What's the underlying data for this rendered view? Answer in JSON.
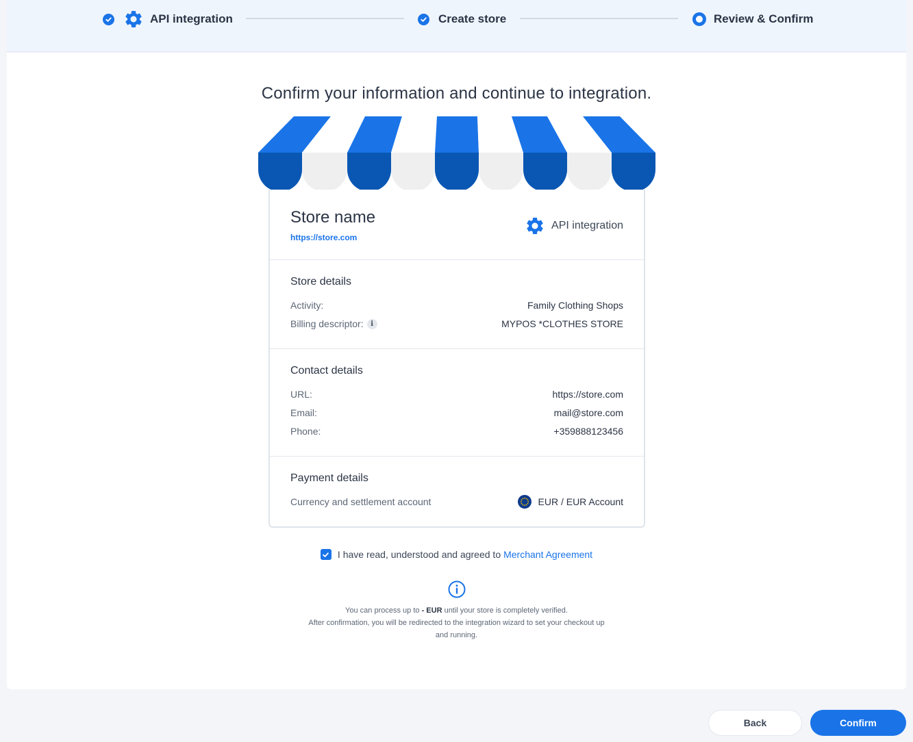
{
  "stepper": {
    "steps": [
      {
        "label": "API integration",
        "state": "done"
      },
      {
        "label": "Create store",
        "state": "done"
      },
      {
        "label": "Review & Confirm",
        "state": "current"
      }
    ]
  },
  "headline": "Confirm your information and continue to integration.",
  "store": {
    "name": "Store name",
    "url": "https://store.com",
    "integration_type": "API integration"
  },
  "store_details": {
    "title": "Store details",
    "activity_label": "Activity:",
    "activity_value": "Family Clothing Shops",
    "billing_label": "Billing descriptor:",
    "billing_value": "MYPOS *CLOTHES STORE",
    "info_glyph": "i"
  },
  "contact_details": {
    "title": "Contact details",
    "url_label": "URL:",
    "url_value": "https://store.com",
    "email_label": "Email:",
    "email_value": "mail@store.com",
    "phone_label": "Phone:",
    "phone_value": "+359888123456"
  },
  "payment_details": {
    "title": "Payment details",
    "currency_label": "Currency and settlement account",
    "currency_value": "EUR / EUR Account"
  },
  "agreement": {
    "checked": true,
    "text": "I have read, understood and agreed to",
    "link": "Merchant Agreement"
  },
  "notice": {
    "line1_pre": "You can process up to ",
    "line1_bold": "- EUR",
    "line1_post": " until your store is completely verified.",
    "line2": "After confirmation, you will be redirected to the integration wizard to set your checkout up",
    "line3": "and running."
  },
  "buttons": {
    "back": "Back",
    "confirm": "Confirm"
  },
  "colors": {
    "accent": "#1a74e8",
    "awning_dark": "#0a57b3",
    "awning_light": "#efeff0"
  }
}
